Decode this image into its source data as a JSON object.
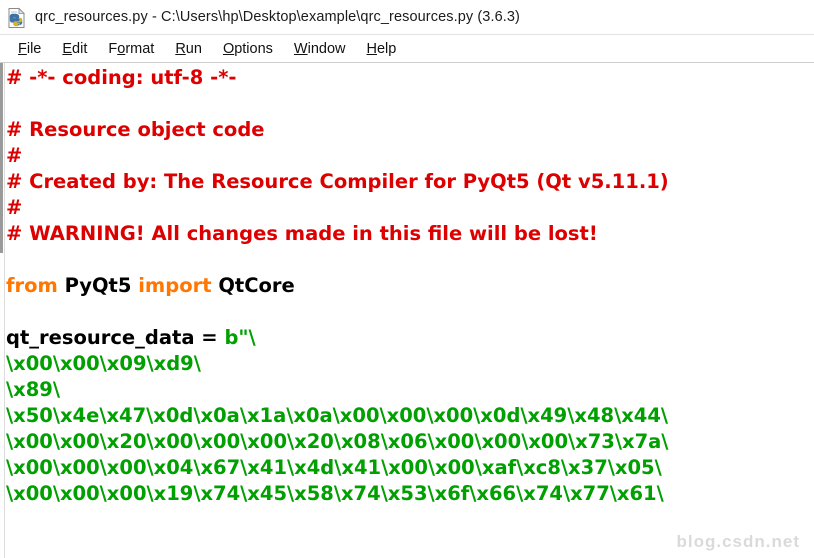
{
  "window": {
    "title": "qrc_resources.py - C:\\Users\\hp\\Desktop\\example\\qrc_resources.py (3.6.3)",
    "icon": "python-file-icon"
  },
  "menubar": {
    "items": [
      {
        "label": "File",
        "mnemonic": "F"
      },
      {
        "label": "Edit",
        "mnemonic": "E"
      },
      {
        "label": "Format",
        "mnemonic": "o"
      },
      {
        "label": "Run",
        "mnemonic": "R"
      },
      {
        "label": "Options",
        "mnemonic": "O"
      },
      {
        "label": "Window",
        "mnemonic": "W"
      },
      {
        "label": "Help",
        "mnemonic": "H"
      }
    ]
  },
  "colors": {
    "comment": "#dd0000",
    "keyword": "#ff7700",
    "string": "#00a000",
    "plain": "#000000",
    "background": "#ffffff",
    "titlebar": "#ffffff"
  },
  "editor": {
    "caret_line": 1,
    "lines": [
      {
        "n": 1,
        "text": "# -*- coding: utf-8 -*-",
        "type": "comment"
      },
      {
        "n": 2,
        "text": "",
        "type": "blank"
      },
      {
        "n": 3,
        "text": "# Resource object code",
        "type": "comment"
      },
      {
        "n": 4,
        "text": "#",
        "type": "comment"
      },
      {
        "n": 5,
        "text": "# Created by: The Resource Compiler for PyQt5 (Qt v5.11.1)",
        "type": "comment"
      },
      {
        "n": 6,
        "text": "#",
        "type": "comment"
      },
      {
        "n": 7,
        "text": "# WARNING! All changes made in this file will be lost!",
        "type": "comment"
      },
      {
        "n": 8,
        "text": "",
        "type": "blank"
      },
      {
        "n": 9,
        "type": "import",
        "segments": [
          {
            "t": "from ",
            "c": "keyword"
          },
          {
            "t": "PyQt5 ",
            "c": "plain"
          },
          {
            "t": "import ",
            "c": "keyword"
          },
          {
            "t": "QtCore",
            "c": "plain"
          }
        ]
      },
      {
        "n": 10,
        "text": "",
        "type": "blank"
      },
      {
        "n": 11,
        "type": "assign",
        "segments": [
          {
            "t": "qt_resource_data = ",
            "c": "plain"
          },
          {
            "t": "b\"\\",
            "c": "string"
          }
        ]
      },
      {
        "n": 12,
        "text": "\\x00\\x00\\x09\\xd9\\",
        "type": "string"
      },
      {
        "n": 13,
        "text": "\\x89\\",
        "type": "string"
      },
      {
        "n": 14,
        "text": "\\x50\\x4e\\x47\\x0d\\x0a\\x1a\\x0a\\x00\\x00\\x00\\x0d\\x49\\x48\\x44\\",
        "type": "string"
      },
      {
        "n": 15,
        "text": "\\x00\\x00\\x20\\x00\\x00\\x00\\x20\\x08\\x06\\x00\\x00\\x00\\x73\\x7a\\",
        "type": "string"
      },
      {
        "n": 16,
        "text": "\\x00\\x00\\x00\\x04\\x67\\x41\\x4d\\x41\\x00\\x00\\xaf\\xc8\\x37\\x05\\",
        "type": "string"
      },
      {
        "n": 17,
        "text": "\\x00\\x00\\x00\\x19\\x74\\x45\\x58\\x74\\x53\\x6f\\x66\\x74\\x77\\x61\\",
        "type": "string"
      }
    ]
  },
  "watermark": {
    "text": "blog.csdn.net"
  }
}
